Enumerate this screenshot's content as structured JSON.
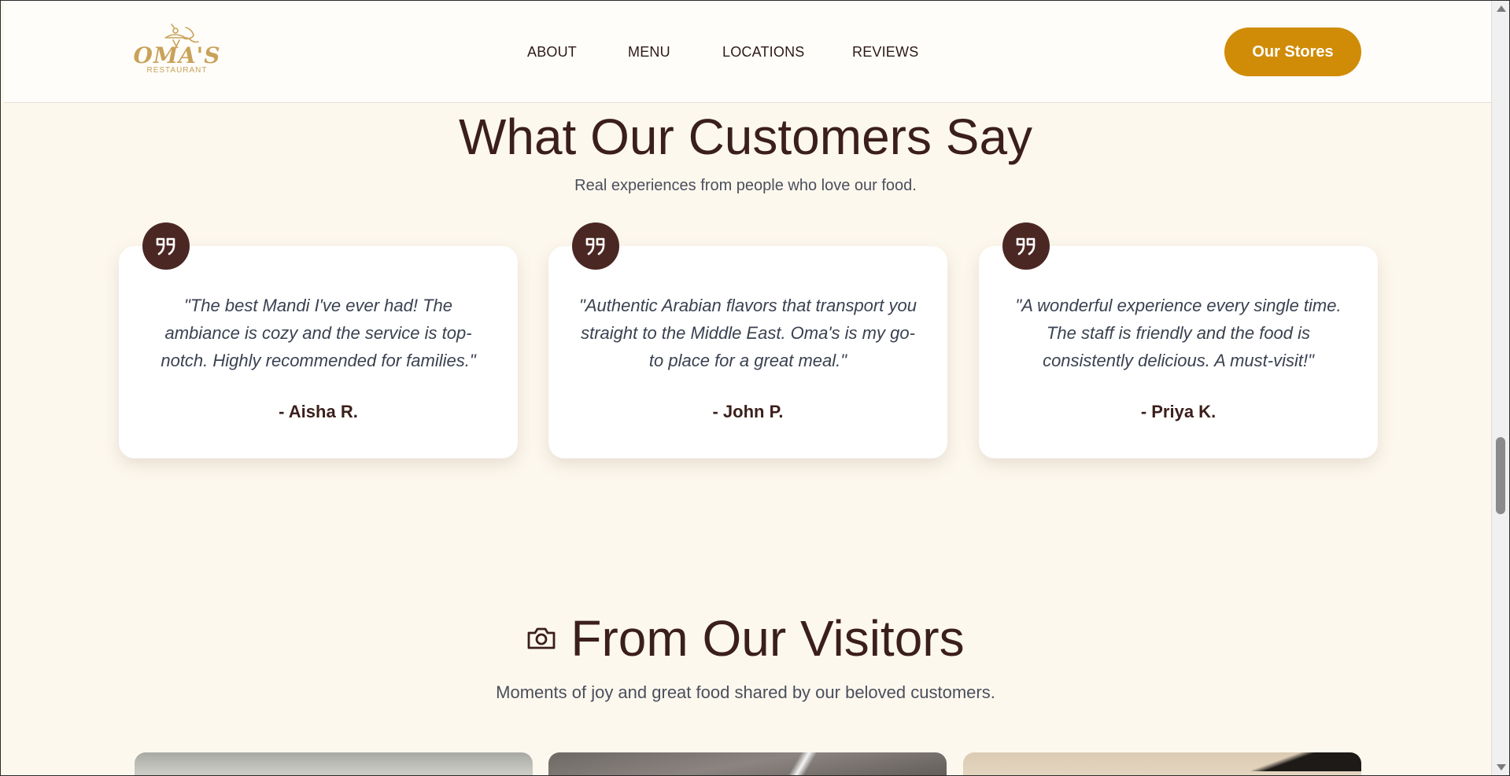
{
  "header": {
    "logo": {
      "name": "OMA'S",
      "sub": "RESTAURANT"
    },
    "nav": [
      "ABOUT",
      "MENU",
      "LOCATIONS",
      "REVIEWS"
    ],
    "cta_label": "Our Stores"
  },
  "testimonials": {
    "title": "What Our Customers Say",
    "subtitle": "Real experiences from people who love our food.",
    "items": [
      {
        "quote": "\"The best Mandi I've ever had! The ambiance is cozy and the service is top-notch. Highly recommended for families.\"",
        "author": "- Aisha R."
      },
      {
        "quote": "\"Authentic Arabian flavors that transport you straight to the Middle East. Oma's is my go-to place for a great meal.\"",
        "author": "- John P."
      },
      {
        "quote": "\"A wonderful experience every single time. The staff is friendly and the food is consistently delicious. A must-visit!\"",
        "author": "- Priya K."
      }
    ]
  },
  "visitors": {
    "title": "From Our Visitors",
    "subtitle": "Moments of joy and great food shared by our beloved customers."
  },
  "colors": {
    "brand_gold": "#d08c07",
    "logo_gold": "#c9a25a",
    "dark_brown": "#3b1f1b",
    "badge_brown": "#4b2723",
    "page_bg": "#fdf8ee"
  },
  "icons": {
    "quote": "quote-icon",
    "camera": "camera-icon"
  }
}
